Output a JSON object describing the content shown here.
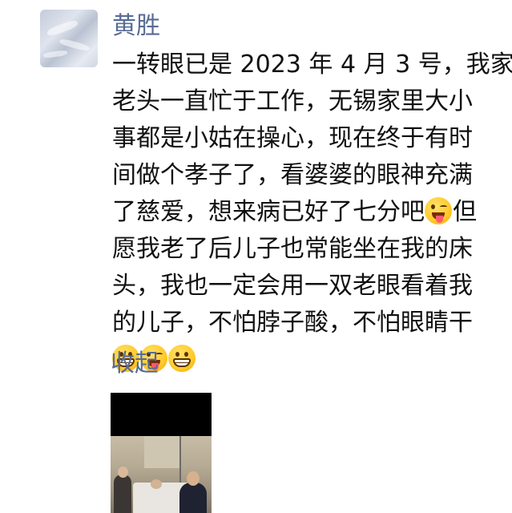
{
  "post": {
    "author": "黄胜",
    "lines": [
      "一转眼已是 2023 年 4 月 3 号，我家",
      "老头一直忙于工作，无锡家里大小",
      "事都是小姑在操心，现在终于有时",
      "间做个孝子了，看婆婆的眼神充满",
      "了慈爱，想来病已好了七分吧",
      "愿我老了后儿子也常能坐在我的床",
      "头，我也一定会用一双老眼看着我",
      "的儿子，不怕脖子酸，不怕眼睛干"
    ],
    "line5_tail": "但",
    "collapse_label": "收起",
    "emojis": [
      "grin-emoji",
      "wink-tongue-emoji",
      "grin-emoji"
    ]
  },
  "colors": {
    "link": "#576b95",
    "text": "#111111"
  }
}
